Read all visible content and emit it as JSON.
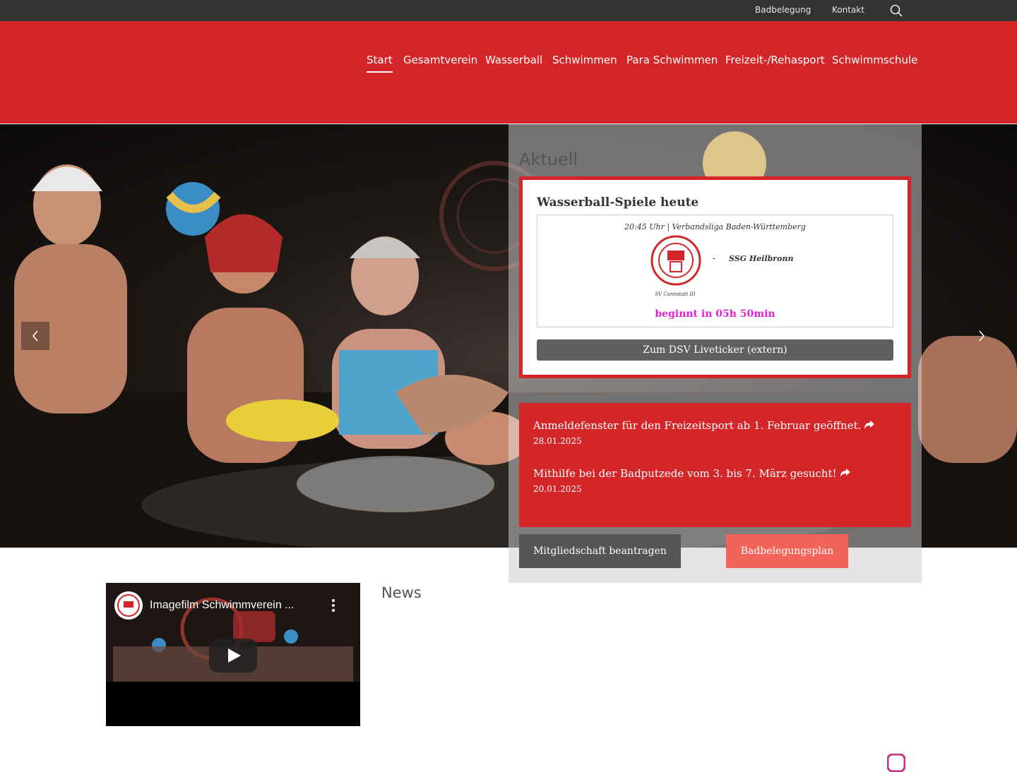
{
  "topbar": {
    "links": [
      "Badbelegung",
      "Kontakt"
    ],
    "search_icon": "search-icon"
  },
  "nav": {
    "items": [
      "Start",
      "Gesamtverein",
      "Wasserball",
      "Schwimmen",
      "Para Schwimmen",
      "Freizeit-/Rehasport",
      "Schwimmschule"
    ],
    "active": "Start"
  },
  "hero": {
    "prev_icon": "chevron-left-icon",
    "next_icon": "chevron-right-icon"
  },
  "aktuell": {
    "heading": "Aktuell",
    "games": {
      "title": "Wasserball-Spiele heute",
      "match": {
        "meta": "20:45 Uhr | Verbandsliga Baden-Württemberg",
        "home_team": "SV Cannstatt III",
        "separator": "-",
        "away_team": "SSG Heilbronn",
        "countdown": "beginnt in 05h 50min"
      },
      "ticker_label": "Zum DSV Liveticker (extern)"
    },
    "news": [
      {
        "title": "Anmeldefenster für den Freizeitsport ab 1. Februar geöffnet.",
        "date": "28.01.2025"
      },
      {
        "title": "Mithilfe bei der Badputzede vom 3. bis 7. März gesucht!",
        "date": "20.01.2025"
      }
    ],
    "buttons": {
      "membership": "Mitgliedschaft beantragen",
      "plan": "Badbelegungsplan"
    }
  },
  "video": {
    "title": "Imagefilm Schwimmverein ...",
    "play_icon": "youtube-play-icon"
  },
  "news_section": {
    "heading": "News"
  },
  "colors": {
    "brand_red": "#d42528",
    "dark": "#333333",
    "countdown": "#e020d0",
    "plan_button": "#f2645a"
  }
}
